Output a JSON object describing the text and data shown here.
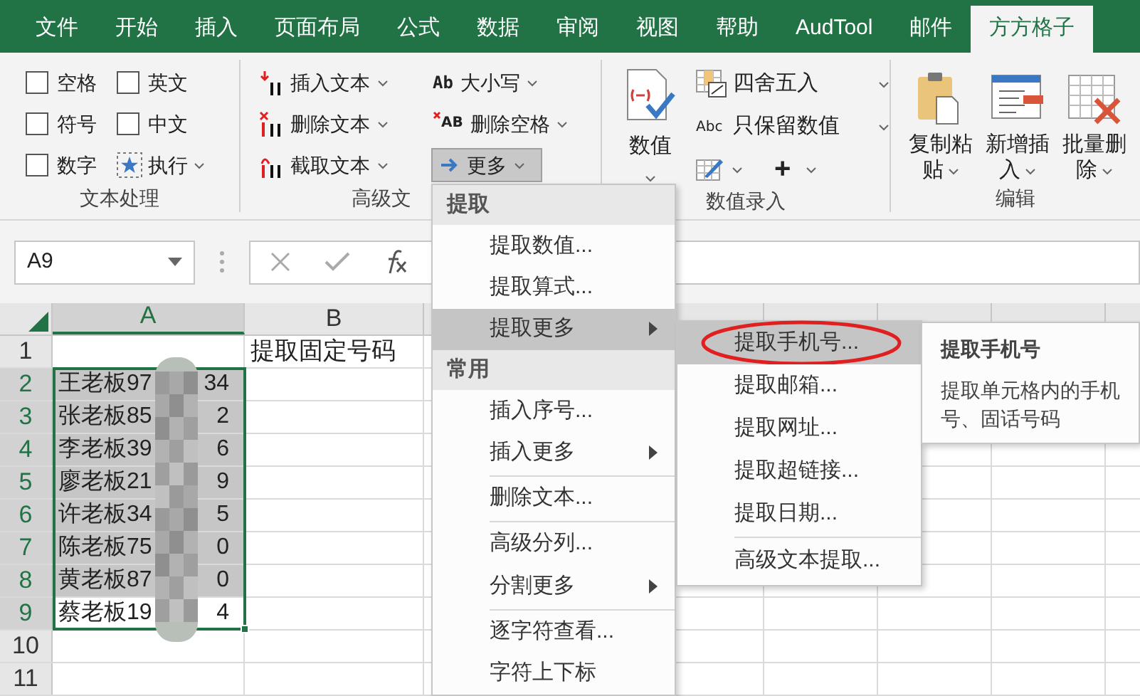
{
  "tabs": [
    {
      "label": "文件",
      "selected": false
    },
    {
      "label": "开始",
      "selected": false
    },
    {
      "label": "插入",
      "selected": false
    },
    {
      "label": "页面布局",
      "selected": false
    },
    {
      "label": "公式",
      "selected": false
    },
    {
      "label": "数据",
      "selected": false
    },
    {
      "label": "审阅",
      "selected": false
    },
    {
      "label": "视图",
      "selected": false
    },
    {
      "label": "帮助",
      "selected": false
    },
    {
      "label": "AudTool",
      "selected": false
    },
    {
      "label": "邮件",
      "selected": false
    },
    {
      "label": "方方格子",
      "selected": true
    }
  ],
  "text_processing": {
    "label": "文本处理",
    "checkboxes": [
      {
        "label": "空格",
        "checked": false
      },
      {
        "label": "英文",
        "checked": false
      },
      {
        "label": "符号",
        "checked": false
      },
      {
        "label": "中文",
        "checked": false
      },
      {
        "label": "数字",
        "checked": false
      }
    ],
    "run_button": "执行"
  },
  "advanced_text": {
    "label": "高级文",
    "buttons": [
      {
        "kind": "insert",
        "label": "插入文本"
      },
      {
        "kind": "case",
        "icon_text": "Ab",
        "label": "大小写"
      },
      {
        "kind": "delete",
        "label": "删除文本"
      },
      {
        "kind": "trim",
        "icon_text": "AB",
        "label": "删除空格"
      },
      {
        "kind": "cut",
        "label": "截取文本"
      },
      {
        "kind": "more",
        "label": "更多",
        "pressed": true
      }
    ]
  },
  "number_entry": {
    "label": "数值录入",
    "big_button": "数值",
    "buttons": [
      {
        "kind": "round",
        "label": "四舍五入"
      },
      {
        "kind": "keep",
        "icon_text": "Abc",
        "label": "只保留数值"
      }
    ],
    "plus_button": "+"
  },
  "edit": {
    "label": "编辑",
    "buttons": [
      {
        "kind": "paste",
        "line_1": "复制粘",
        "line_2": "贴"
      },
      {
        "kind": "insert",
        "line_1": "新增插",
        "line_2": "入"
      },
      {
        "kind": "delete",
        "line_1": "批量删",
        "line_2": "除"
      }
    ]
  },
  "name_box": "A9",
  "columns": [
    {
      "letter": "A"
    },
    {
      "letter": "B"
    }
  ],
  "rows": [
    {
      "number": "1",
      "b": "提取固定号码",
      "selected": false,
      "shaded": false
    },
    {
      "number": "2",
      "a_start": "王老板97",
      "a_end": "34",
      "selected": true,
      "shaded": true
    },
    {
      "number": "3",
      "a_start": "张老板85",
      "a_end": "2",
      "selected": true,
      "shaded": true
    },
    {
      "number": "4",
      "a_start": "李老板39",
      "a_end": "6",
      "selected": true,
      "shaded": true
    },
    {
      "number": "5",
      "a_start": "廖老板21",
      "a_end": "9",
      "selected": true,
      "shaded": true
    },
    {
      "number": "6",
      "a_start": "许老板34",
      "a_end": "5",
      "selected": true,
      "shaded": true
    },
    {
      "number": "7",
      "a_start": "陈老板75",
      "a_end": "0",
      "selected": true,
      "shaded": true
    },
    {
      "number": "8",
      "a_start": "黄老板87",
      "a_end": "0",
      "selected": true,
      "shaded": true
    },
    {
      "number": "9",
      "a_start": "蔡老板19",
      "a_end": "4",
      "selected": true,
      "shaded": false
    },
    {
      "number": "10",
      "selected": false,
      "shaded": false
    },
    {
      "number": "11",
      "selected": false,
      "shaded": false
    }
  ],
  "menu": {
    "items": [
      {
        "kind": "header",
        "label": "提取"
      },
      {
        "kind": "item",
        "label": "提取数值...",
        "selected": false
      },
      {
        "kind": "item",
        "label": "提取算式...",
        "selected": false
      },
      {
        "kind": "submenu",
        "label": "提取更多",
        "selected": true
      },
      {
        "kind": "header",
        "label": "常用"
      },
      {
        "kind": "item",
        "label": "插入序号...",
        "selected": false
      },
      {
        "kind": "submenu",
        "label": "插入更多",
        "selected": false
      },
      {
        "kind": "separator"
      },
      {
        "kind": "item",
        "label": "删除文本...",
        "selected": false
      },
      {
        "kind": "separator"
      },
      {
        "kind": "item",
        "label": "高级分列...",
        "selected": false
      },
      {
        "kind": "submenu",
        "label": "分割更多",
        "selected": false
      },
      {
        "kind": "separator"
      },
      {
        "kind": "item",
        "label": "逐字符查看...",
        "selected": false
      },
      {
        "kind": "item",
        "label": "字符上下标",
        "selected": false
      }
    ]
  },
  "submenu": {
    "items": [
      {
        "kind": "item",
        "label": "提取手机号...",
        "selected": true,
        "circled": true
      },
      {
        "kind": "item",
        "label": "提取邮箱...",
        "selected": false,
        "circled": false
      },
      {
        "kind": "item",
        "label": "提取网址...",
        "selected": false,
        "circled": false
      },
      {
        "kind": "item",
        "label": "提取超链接...",
        "selected": false,
        "circled": false
      },
      {
        "kind": "item",
        "label": "提取日期...",
        "selected": false,
        "circled": false
      },
      {
        "kind": "separator"
      },
      {
        "kind": "item",
        "label": "高级文本提取...",
        "selected": false,
        "circled": false
      }
    ]
  },
  "tooltip": {
    "title": "提取手机号",
    "description": "提取单元格内的手机号、固话号码"
  }
}
